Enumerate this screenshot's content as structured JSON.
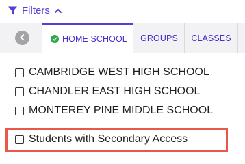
{
  "header": {
    "filters_label": "Filters",
    "filters_icon": "funnel-icon",
    "toggle_icon": "chevron-up-icon",
    "accent_color": "#5b3bd6"
  },
  "tabs": [
    {
      "label": "HOME SCHOOL",
      "active": true,
      "icon": "check-circle-icon"
    },
    {
      "label": "GROUPS",
      "active": false
    },
    {
      "label": "CLASSES",
      "active": false
    }
  ],
  "schools": [
    {
      "label": "CAMBRIDGE WEST HIGH SCHOOL",
      "checked": false
    },
    {
      "label": "CHANDLER EAST HIGH SCHOOL",
      "checked": false
    },
    {
      "label": "MONTEREY PINE MIDDLE SCHOOL",
      "checked": false
    }
  ],
  "secondary_access": {
    "label": "Students with Secondary Access",
    "checked": false,
    "highlight_color": "#e8574a"
  }
}
